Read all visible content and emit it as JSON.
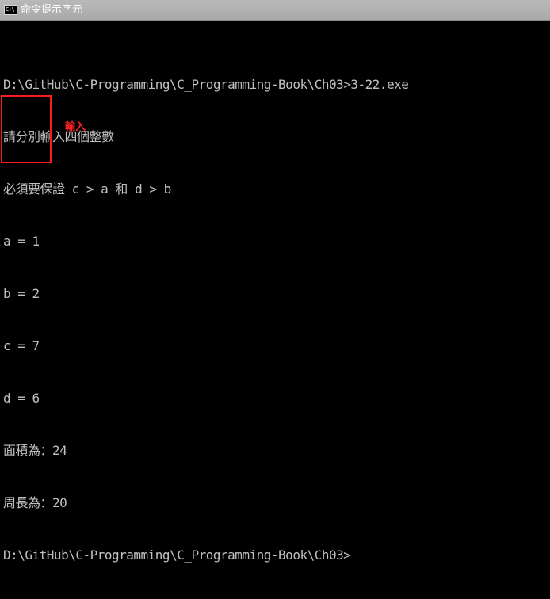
{
  "window": {
    "title": "命令提示字元",
    "icon_label": "C:\\",
    "icon_name": "command-prompt-icon"
  },
  "console": {
    "lines": [
      "D:\\GitHub\\C-Programming\\C_Programming-Book\\Ch03>3-22.exe",
      "請分別輸入四個整數",
      "必須要保證 c > a 和 d > b",
      "a = 1",
      "b = 2",
      "c = 7",
      "d = 6",
      "面積為：24",
      "周長為：20",
      "D:\\GitHub\\C-Programming\\C_Programming-Book\\Ch03>"
    ]
  },
  "annotation": {
    "label": "輸入",
    "color": "#ff2020"
  },
  "colors": {
    "background": "#000000",
    "text": "#c0c0c0",
    "highlight": "#ff1a1a"
  }
}
